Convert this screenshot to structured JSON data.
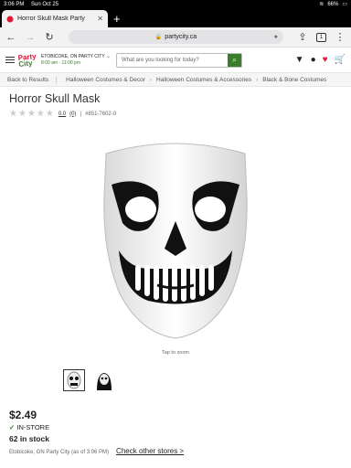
{
  "status": {
    "time": "3:06 PM",
    "date": "Sun Oct 25",
    "battery": "66%"
  },
  "browser": {
    "tab_title": "Horror Skull Mask Party",
    "tab_count": "1",
    "url": "partycity.ca"
  },
  "site": {
    "logo_top": "Party",
    "logo_bottom": "City",
    "store_name": "ETOBICOKE, ON PARTY CITY",
    "store_hours": "8:00 am - 11:00 pm",
    "search_placeholder": "What are you looking for today?"
  },
  "breadcrumb": {
    "back": "Back to Results",
    "items": [
      "Halloween Costumes & Decor",
      "Halloween Costumes & Accessories",
      "Black & Bone Costumes"
    ]
  },
  "product": {
    "title": "Horror Skull Mask",
    "rating": "0.0",
    "reviews": "(0)",
    "sku": "#851-7602-0",
    "zoom_hint": "Tap to zoom",
    "price": "$2.49",
    "availability": "IN-STORE",
    "stock": "62 in stock",
    "location": "Etobicoke, ON Party City (as of 3:06 PM)",
    "check_other": "Check other stores >"
  }
}
